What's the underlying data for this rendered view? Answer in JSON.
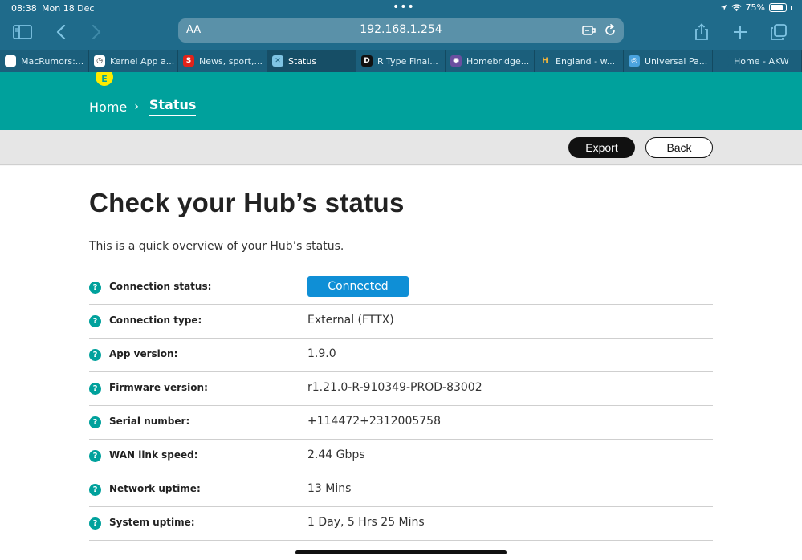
{
  "status_bar": {
    "time": "08:38",
    "date": "Mon 18 Dec",
    "battery": "75%"
  },
  "browser": {
    "aa_label": "AA",
    "url": "192.168.1.254",
    "tabs": [
      {
        "label": "MacRumors:...",
        "fav_text": "",
        "fav_color": "#ffffff",
        "fav_fg": "#c8102e"
      },
      {
        "label": "Kernel App a...",
        "fav_text": "◷",
        "fav_color": "#ffffff",
        "fav_fg": "#222222"
      },
      {
        "label": "News, sport,...",
        "fav_text": "S",
        "fav_color": "#e2231a",
        "fav_fg": "#ffffff"
      },
      {
        "label": "Status",
        "fav_text": "✕",
        "fav_color": "#7fc4e3",
        "fav_fg": "#1b5f7c"
      },
      {
        "label": "R Type Final...",
        "fav_text": "D",
        "fav_color": "#111111",
        "fav_fg": "#ffffff"
      },
      {
        "label": "Homebridge...",
        "fav_text": "◉",
        "fav_color": "#6a4fa0",
        "fav_fg": "#ffffff"
      },
      {
        "label": "England - w...",
        "fav_text": "H",
        "fav_color": "#1b5f7c",
        "fav_fg": "#f3b53b"
      },
      {
        "label": "Universal Pa...",
        "fav_text": "◎",
        "fav_color": "#4aa3df",
        "fav_fg": "#ffffff"
      },
      {
        "label": "Home - AKW",
        "fav_text": "",
        "fav_color": "#1b5f7c",
        "fav_fg": "#e2231a"
      }
    ]
  },
  "header": {
    "logo": "E",
    "crumb_home": "Home",
    "crumb_sep": "›",
    "crumb_current": "Status"
  },
  "actions": {
    "export_label": "Export",
    "back_label": "Back"
  },
  "page": {
    "title": "Check your Hub’s status",
    "intro": "This is a quick overview of your Hub’s status."
  },
  "status_rows": [
    {
      "label": "Connection status:",
      "value": "Connected",
      "badge": true
    },
    {
      "label": "Connection type:",
      "value": "External (FTTX)",
      "badge": false
    },
    {
      "label": "App version:",
      "value": "1.9.0",
      "badge": false
    },
    {
      "label": "Firmware version:",
      "value": "r1.21.0-R-910349-PROD-83002",
      "badge": false
    },
    {
      "label": "Serial number:",
      "value": "+114472+2312005758",
      "badge": false
    },
    {
      "label": "WAN link speed:",
      "value": "2.44 Gbps",
      "badge": false
    },
    {
      "label": "Network uptime:",
      "value": "13 Mins",
      "badge": false
    },
    {
      "label": "System uptime:",
      "value": "1 Day, 5 Hrs 25 Mins",
      "badge": false
    }
  ],
  "colors": {
    "brand_teal": "#00a19c",
    "badge_blue": "#0f8fd6",
    "brand_yellow": "#ffeb00"
  }
}
